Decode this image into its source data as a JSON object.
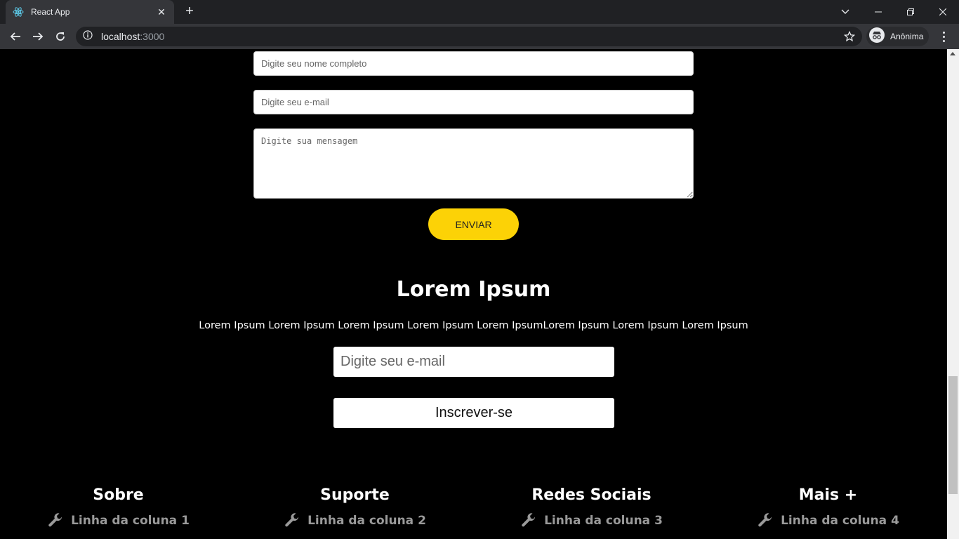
{
  "browser": {
    "tab_title": "React App",
    "url_host": "localhost",
    "url_port": ":3000",
    "profile_label": "Anônima"
  },
  "contact_form": {
    "name_placeholder": "Digite seu nome completo",
    "email_placeholder": "Digite seu e-mail",
    "message_placeholder": "Digite sua mensagem",
    "submit_label": "ENVIAR"
  },
  "newsletter": {
    "title": "Lorem Ipsum",
    "text": "Lorem Ipsum Lorem Ipsum Lorem Ipsum Lorem Ipsum Lorem IpsumLorem Ipsum Lorem Ipsum Lorem Ipsum",
    "email_placeholder": "Digite seu e-mail",
    "subscribe_label": "Inscrever-se"
  },
  "footer": {
    "columns": [
      {
        "title": "Sobre",
        "link": "Linha da coluna 1"
      },
      {
        "title": "Suporte",
        "link": "Linha da coluna 2"
      },
      {
        "title": "Redes Sociais",
        "link": "Linha da coluna 3"
      },
      {
        "title": "Mais +",
        "link": "Linha da coluna 4"
      }
    ]
  },
  "colors": {
    "accent_button": "#fcd206",
    "page_background": "#000000",
    "footer_link": "#9a9a9a"
  },
  "icons": [
    "react-logo-icon",
    "close-icon",
    "plus-icon",
    "back-icon",
    "forward-icon",
    "reload-icon",
    "info-icon",
    "star-icon",
    "incognito-icon",
    "menu-icon",
    "wrench-icon"
  ]
}
